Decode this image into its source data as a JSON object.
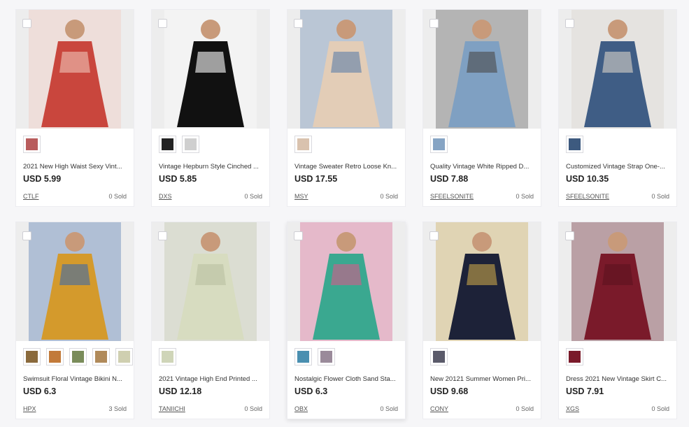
{
  "products": [
    {
      "title": "2021 New High Waist Sexy Vint...",
      "price": "USD 5.99",
      "store": "CTLF",
      "sold": "0 Sold",
      "colors": [
        "#c9463d",
        "#f0c3b8"
      ],
      "swatches": [
        "#b85c5c"
      ]
    },
    {
      "title": "Vintage Hepburn Style Cinched ...",
      "price": "USD 5.85",
      "store": "DXS",
      "sold": "0 Sold",
      "colors": [
        "#111111",
        "#ffffff"
      ],
      "swatches": [
        "#222222",
        "#cfcfcf"
      ]
    },
    {
      "title": "Vintage Sweater Retro Loose Kn...",
      "price": "USD 17.55",
      "store": "MSY",
      "sold": "0 Sold",
      "colors": [
        "#e3cdb7",
        "#5d7fa8"
      ],
      "swatches": [
        "#d9c2ae"
      ]
    },
    {
      "title": "Quality Vintage White Ripped D...",
      "price": "USD 7.88",
      "store": "SFEELSONITE",
      "sold": "0 Sold",
      "colors": [
        "#7fa0c2",
        "#4a4a4a"
      ],
      "swatches": [
        "#86a4c4"
      ]
    },
    {
      "title": "Customized Vintage Strap One-...",
      "price": "USD 10.35",
      "store": "SFEELSONITE",
      "sold": "0 Sold",
      "colors": [
        "#3f5d85",
        "#d8d2c8"
      ],
      "swatches": [
        "#3d5a7f"
      ]
    },
    {
      "title": "Swimsuit Floral Vintage Bikini N...",
      "price": "USD 6.3",
      "store": "HPX",
      "sold": "3 Sold",
      "colors": [
        "#d49a2c",
        "#3e6aa8"
      ],
      "swatches": [
        "#8a6a3c",
        "#c27a3a",
        "#7a8c5a",
        "#b08a5a",
        "#cfcfb0"
      ]
    },
    {
      "title": "2021 Vintage High End Printed ...",
      "price": "USD 12.18",
      "store": "TANIICHI",
      "sold": "0 Sold",
      "colors": [
        "#d7dcc0",
        "#b9c0a0"
      ],
      "swatches": [
        "#cfd5b8"
      ]
    },
    {
      "title": "Nostalgic Flower Cloth Sand Sta...",
      "price": "USD 6.3",
      "store": "OBX",
      "sold": "0 Sold",
      "colors": [
        "#3aa890",
        "#d65a8a"
      ],
      "swatches": [
        "#4a8fb0",
        "#9a8a9a"
      ]
    },
    {
      "title": "New 20121 Summer Women Pri...",
      "price": "USD 9.68",
      "store": "CONY",
      "sold": "0 Sold",
      "colors": [
        "#1d2238",
        "#c8a54a"
      ],
      "swatches": [
        "#5a5a6a"
      ]
    },
    {
      "title": "Dress 2021 New Vintage Skirt C...",
      "price": "USD 7.91",
      "store": "XGS",
      "sold": "0 Sold",
      "colors": [
        "#7a1a2a",
        "#5c1220"
      ],
      "swatches": [
        "#7a1a2a"
      ]
    }
  ]
}
